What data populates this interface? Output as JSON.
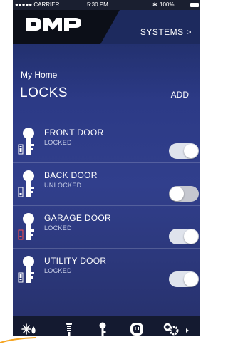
{
  "status_bar": {
    "carrier": "●●●●● CARRIER",
    "time": "5:30 PM",
    "battery": "100%"
  },
  "header": {
    "brand": "DMP",
    "systems_link": "SYSTEMS >"
  },
  "page": {
    "location": "My Home",
    "title": "LOCKS",
    "add_label": "ADD"
  },
  "locks": [
    {
      "name": "FRONT DOOR",
      "status": "LOCKED",
      "on": true
    },
    {
      "name": "BACK DOOR",
      "status": "UNLOCKED",
      "on": false
    },
    {
      "name": "GARAGE DOOR",
      "status": "LOCKED",
      "on": true
    },
    {
      "name": "UTILITY DOOR",
      "status": "LOCKED",
      "on": true
    }
  ],
  "bottom_nav": [
    {
      "icon": "thermostat-icon"
    },
    {
      "icon": "light-bulb-icon"
    },
    {
      "icon": "lock-key-icon",
      "active": true
    },
    {
      "icon": "outlet-icon"
    },
    {
      "icon": "gears-icon"
    }
  ],
  "colors": {
    "accent": "#2c3a86",
    "toggle_on": "#dfe3ec",
    "toggle_off": "#c5c7cf"
  }
}
